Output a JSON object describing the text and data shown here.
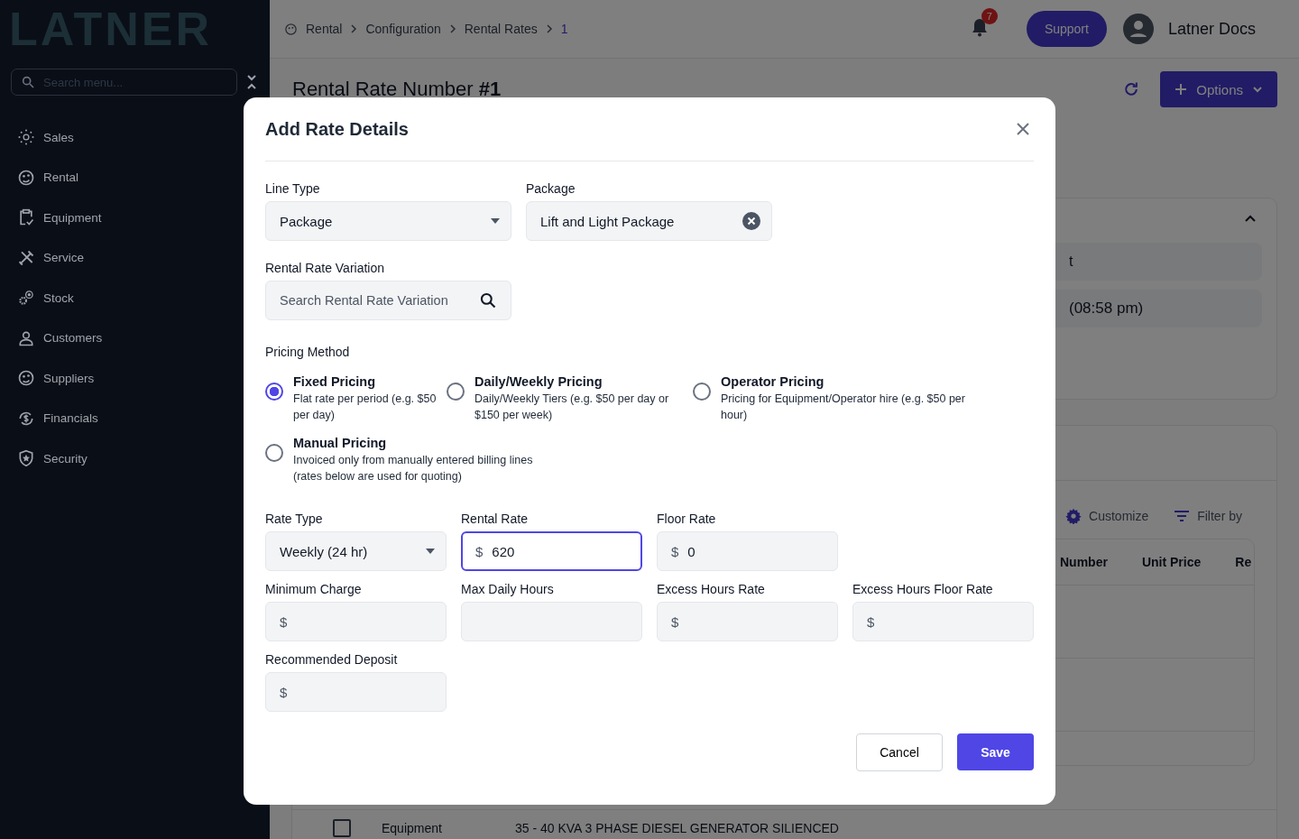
{
  "sidebar": {
    "logo": "LATNER",
    "search": {
      "placeholder": "Search menu..."
    },
    "items": [
      {
        "label": "Sales"
      },
      {
        "label": "Rental"
      },
      {
        "label": "Equipment"
      },
      {
        "label": "Service"
      },
      {
        "label": "Stock"
      },
      {
        "label": "Customers"
      },
      {
        "label": "Suppliers"
      },
      {
        "label": "Financials"
      },
      {
        "label": "Security"
      }
    ]
  },
  "header": {
    "breadcrumbs": [
      {
        "label": "Rental",
        "current": false
      },
      {
        "label": "Configuration",
        "current": false
      },
      {
        "label": "Rental Rates",
        "current": false
      },
      {
        "label": "1",
        "current": true
      }
    ],
    "notifications": "7",
    "support": "Support",
    "user": "Latner Docs"
  },
  "page": {
    "title": "Rental Rate Number **#1**",
    "options": "Options",
    "details_card": {
      "field_1": "t",
      "field_2": "(08:58 pm)"
    },
    "items_card": {
      "customize": "Customize",
      "filter": "Filter by",
      "columns": [
        "Number",
        "Unit Price",
        "Re"
      ],
      "row": {
        "checked": false,
        "type": "Equipment",
        "description": "35 - 40 KVA 3 PHASE DIESEL GENERATOR SILIENCED"
      }
    }
  },
  "modal": {
    "title": "Add Rate Details",
    "line_type": {
      "label": "Line Type",
      "value": "Package"
    },
    "package": {
      "label": "Package",
      "value": "Lift and Light Package"
    },
    "variation": {
      "label": "Rental Rate Variation",
      "placeholder": "Search Rental Rate Variation"
    },
    "pricing_method": {
      "label": "Pricing Method",
      "options": [
        {
          "title": "Fixed Pricing",
          "description": "Flat rate per period (e.g. $50 per day)",
          "selected": true
        },
        {
          "title": "Daily/Weekly Pricing",
          "description": "Daily/Weekly Tiers (e.g. $50 per day or $150 per week)",
          "selected": false
        },
        {
          "title": "Operator Pricing",
          "description": "Pricing for Equipment/Operator hire (e.g. $50 per hour)",
          "selected": false
        },
        {
          "title": "Manual Pricing",
          "description": "Invoiced only from manually entered billing lines (rates below are used for quoting)",
          "selected": false
        }
      ]
    },
    "rate_fields": [
      {
        "label": "Rate Type",
        "kind": "select",
        "value": "Weekly (24 hr)",
        "focused": false
      },
      {
        "label": "Rental Rate",
        "kind": "money",
        "currency": "$",
        "value": "620",
        "focused": true
      },
      {
        "label": "Floor Rate",
        "kind": "money",
        "currency": "$",
        "value": "0",
        "focused": false
      },
      {
        "kind": "blank"
      },
      {
        "label": "Minimum Charge",
        "kind": "money",
        "currency": "$",
        "focused": false
      },
      {
        "label": "Max Daily Hours",
        "kind": "number",
        "focused": false
      },
      {
        "label": "Excess Hours Rate",
        "kind": "money",
        "currency": "$",
        "focused": false
      },
      {
        "label": "Excess Hours Floor Rate",
        "kind": "money",
        "currency": "$",
        "focused": false
      },
      {
        "label": "Recommended Deposit",
        "kind": "money",
        "currency": "$",
        "focused": false
      }
    ],
    "cancel": "Cancel",
    "save": "Save"
  }
}
